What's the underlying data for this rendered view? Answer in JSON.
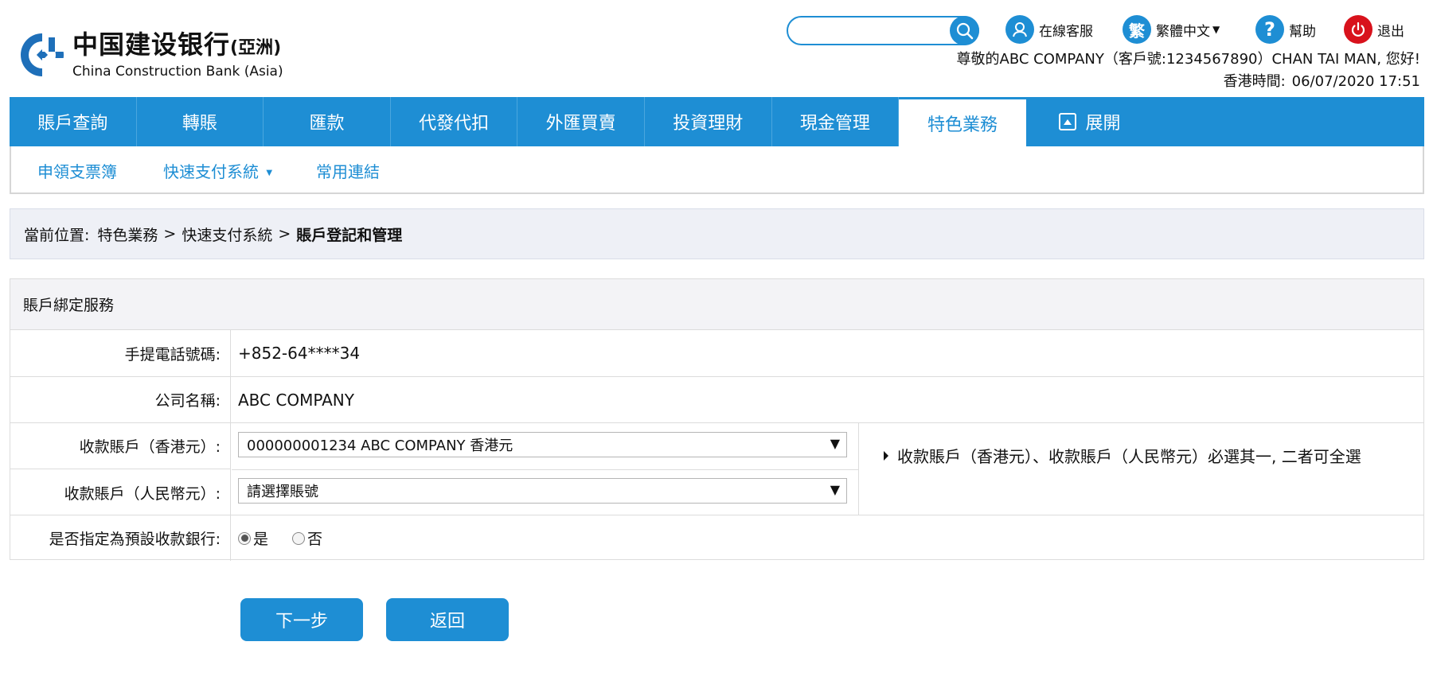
{
  "brand": {
    "name_cn": "中国建设银行",
    "name_cn_suffix": "(亞洲)",
    "name_en": "China Construction Bank (Asia)",
    "brand_color": "#1e8ed4"
  },
  "search": {
    "placeholder": "",
    "icon": "search-icon"
  },
  "utility": {
    "service_label": "在線客服",
    "language_icon": "繁",
    "language_label": "繁體中文",
    "help_icon": "?",
    "help_label": "幫助",
    "logout_label": "退出"
  },
  "greeting": "尊敬的ABC COMPANY（客戶號:1234567890）CHAN TAI MAN, 您好!",
  "time": {
    "label": "香港時間:",
    "value": "06/07/2020 17:51"
  },
  "nav": {
    "items": [
      "賬戶查詢",
      "轉賬",
      "匯款",
      "代發代扣",
      "外匯買賣",
      "投資理財",
      "現金管理",
      "特色業務"
    ],
    "active": "特色業務",
    "expand_label": "展開"
  },
  "subnav": {
    "items": [
      "申領支票簿",
      "快速支付系統",
      "常用連結"
    ]
  },
  "breadcrumb": {
    "prefix": "當前位置:",
    "path": [
      "特色業務",
      "快速支付系統"
    ],
    "separator": ">",
    "current": "賬戶登記和管理"
  },
  "form": {
    "title": "賬戶綁定服務",
    "mobile_label": "手提電話號碼:",
    "mobile_value": "+852-64****34",
    "company_label": "公司名稱:",
    "company_value": "ABC COMPANY",
    "hkd_label": "收款賬戶（香港元）:",
    "hkd_value": "000000001234 ABC COMPANY 香港元",
    "rmb_label": "收款賬戶（人民幣元）:",
    "rmb_value": "請選擇賬號",
    "note": "收款賬戶（香港元）、收款賬戶（人民幣元）必選其一, 二者可全選",
    "default_label": "是否指定為預設收款銀行:",
    "default_options": [
      "是",
      "否"
    ],
    "default_selected": "是"
  },
  "buttons": {
    "next": "下一步",
    "back": "返回"
  }
}
